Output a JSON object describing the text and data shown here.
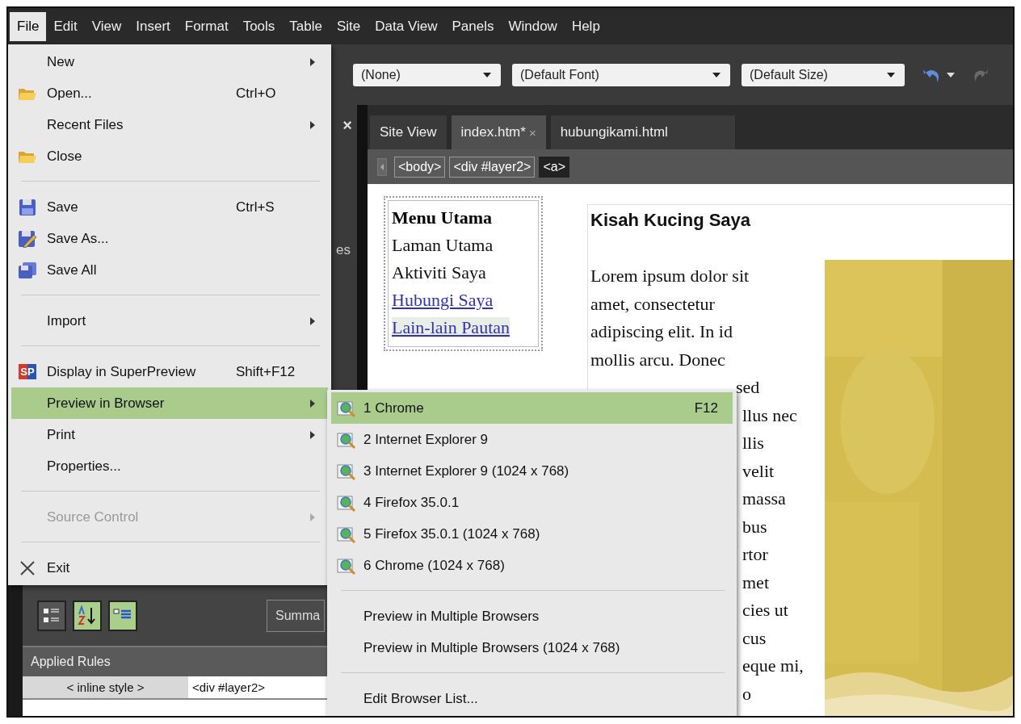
{
  "menu_bar": [
    {
      "label": "File",
      "selected": true
    },
    {
      "label": "Edit",
      "selected": false
    },
    {
      "label": "View",
      "selected": false
    },
    {
      "label": "Insert",
      "selected": false
    },
    {
      "label": "Format",
      "selected": false
    },
    {
      "label": "Tools",
      "selected": false
    },
    {
      "label": "Table",
      "selected": false
    },
    {
      "label": "Site",
      "selected": false
    },
    {
      "label": "Data View",
      "selected": false
    },
    {
      "label": "Panels",
      "selected": false
    },
    {
      "label": "Window",
      "selected": false
    },
    {
      "label": "Help",
      "selected": false
    }
  ],
  "toolbar": {
    "dropdowns": [
      {
        "value": "(None)"
      },
      {
        "value": "(Default Font)"
      },
      {
        "value": "(Default Size)"
      }
    ]
  },
  "left_panel": {
    "close": "×",
    "tab_fragment": "es",
    "view_buttons": [
      {
        "selected": false
      },
      {
        "selected": true
      },
      {
        "selected": true
      }
    ],
    "summary_button": "Summa",
    "applied_rules": {
      "header": "Applied Rules",
      "cells": [
        "< inline style >",
        "<div #layer2>"
      ]
    }
  },
  "tabs": [
    {
      "label": "Site View",
      "selected": false
    },
    {
      "label": "index.htm*",
      "selected": true,
      "close": "×"
    },
    {
      "label": "hubungikami.html",
      "selected": false
    }
  ],
  "breadcrumb": [
    {
      "label": "<body>",
      "selected": false
    },
    {
      "label": "<div #layer2>",
      "selected": false
    },
    {
      "label": "<a>",
      "selected": true
    }
  ],
  "page": {
    "menu": {
      "title": "Menu Utama",
      "items": [
        {
          "label": "Laman Utama",
          "link": false,
          "highlighted": false
        },
        {
          "label": "Aktiviti Saya",
          "link": false,
          "highlighted": false
        },
        {
          "label": "Hubungi Saya",
          "link": true,
          "highlighted": false
        },
        {
          "label": "Lain-lain Pautan",
          "link": true,
          "highlighted": true
        }
      ]
    },
    "heading": "Kisah Kucing Saya",
    "paragraph_lines": [
      {
        "kind": "full",
        "text": "Lorem ipsum dolor sit"
      },
      {
        "kind": "full",
        "text": "amet, consectetur"
      },
      {
        "kind": "full",
        "text": "adipiscing elit. In id"
      },
      {
        "kind": "full",
        "text": "mollis arcu. Donec"
      },
      {
        "kind": "fragment",
        "text": "sed"
      },
      {
        "kind": "fragment",
        "text": "llus nec"
      },
      {
        "kind": "fragment",
        "text": "llis"
      },
      {
        "kind": "fragment",
        "text": "velit"
      },
      {
        "kind": "fragment",
        "text": "massa"
      },
      {
        "kind": "fragment",
        "text": "bus"
      },
      {
        "kind": "fragment",
        "text": "rtor"
      },
      {
        "kind": "fragment",
        "text": "met"
      },
      {
        "kind": "fragment",
        "text": "cies ut"
      },
      {
        "kind": "fragment",
        "text": "cus"
      },
      {
        "kind": "fragment",
        "text": "eque mi,"
      },
      {
        "kind": "fragment",
        "text": "o"
      }
    ]
  },
  "file_menu": {
    "items": [
      {
        "kind": "item",
        "label": "New",
        "submenu": true,
        "disabled": false,
        "selected": false
      },
      {
        "kind": "item",
        "label": "Open...",
        "shortcut": "Ctrl+O",
        "submenu": false,
        "disabled": false,
        "selected": false
      },
      {
        "kind": "item",
        "label": "Recent Files",
        "submenu": true,
        "disabled": false,
        "selected": false
      },
      {
        "kind": "item",
        "label": "Close",
        "submenu": false,
        "disabled": false,
        "selected": false
      },
      {
        "kind": "separator"
      },
      {
        "kind": "item",
        "label": "Save",
        "shortcut": "Ctrl+S",
        "submenu": false,
        "disabled": false,
        "selected": false
      },
      {
        "kind": "item",
        "label": "Save As...",
        "submenu": false,
        "disabled": false,
        "selected": false
      },
      {
        "kind": "item",
        "label": "Save All",
        "submenu": false,
        "disabled": false,
        "selected": false
      },
      {
        "kind": "separator"
      },
      {
        "kind": "item",
        "label": "Import",
        "submenu": true,
        "disabled": false,
        "selected": false
      },
      {
        "kind": "separator"
      },
      {
        "kind": "item",
        "label": "Display in SuperPreview",
        "shortcut": "Shift+F12",
        "badge": "SP",
        "submenu": false,
        "disabled": false,
        "selected": false
      },
      {
        "kind": "item",
        "label": "Preview in Browser",
        "submenu": true,
        "disabled": false,
        "selected": true
      },
      {
        "kind": "item",
        "label": "Print",
        "submenu": true,
        "disabled": false,
        "selected": false
      },
      {
        "kind": "item",
        "label": "Properties...",
        "submenu": false,
        "disabled": false,
        "selected": false
      },
      {
        "kind": "separator"
      },
      {
        "kind": "item",
        "label": "Source Control",
        "submenu": true,
        "disabled": true,
        "selected": false
      },
      {
        "kind": "separator"
      },
      {
        "kind": "item",
        "label": "Exit",
        "submenu": false,
        "disabled": false,
        "selected": false
      }
    ]
  },
  "preview_submenu": {
    "items": [
      {
        "kind": "browser",
        "label": "1 Chrome",
        "shortcut": "F12",
        "selected": true
      },
      {
        "kind": "browser",
        "label": "2 Internet Explorer 9",
        "selected": false
      },
      {
        "kind": "browser",
        "label": "3 Internet Explorer 9 (1024 x 768)",
        "selected": false
      },
      {
        "kind": "browser",
        "label": "4 Firefox 35.0.1",
        "selected": false
      },
      {
        "kind": "browser",
        "label": "5 Firefox 35.0.1 (1024 x 768)",
        "selected": false
      },
      {
        "kind": "browser",
        "label": "6 Chrome (1024 x 768)",
        "selected": false
      },
      {
        "kind": "separator"
      },
      {
        "kind": "action",
        "label": "Preview in Multiple Browsers",
        "selected": false
      },
      {
        "kind": "action",
        "label": "Preview in Multiple Browsers (1024 x 768)",
        "selected": false
      },
      {
        "kind": "separator"
      },
      {
        "kind": "action",
        "label": "Edit Browser List...",
        "selected": false
      }
    ]
  }
}
